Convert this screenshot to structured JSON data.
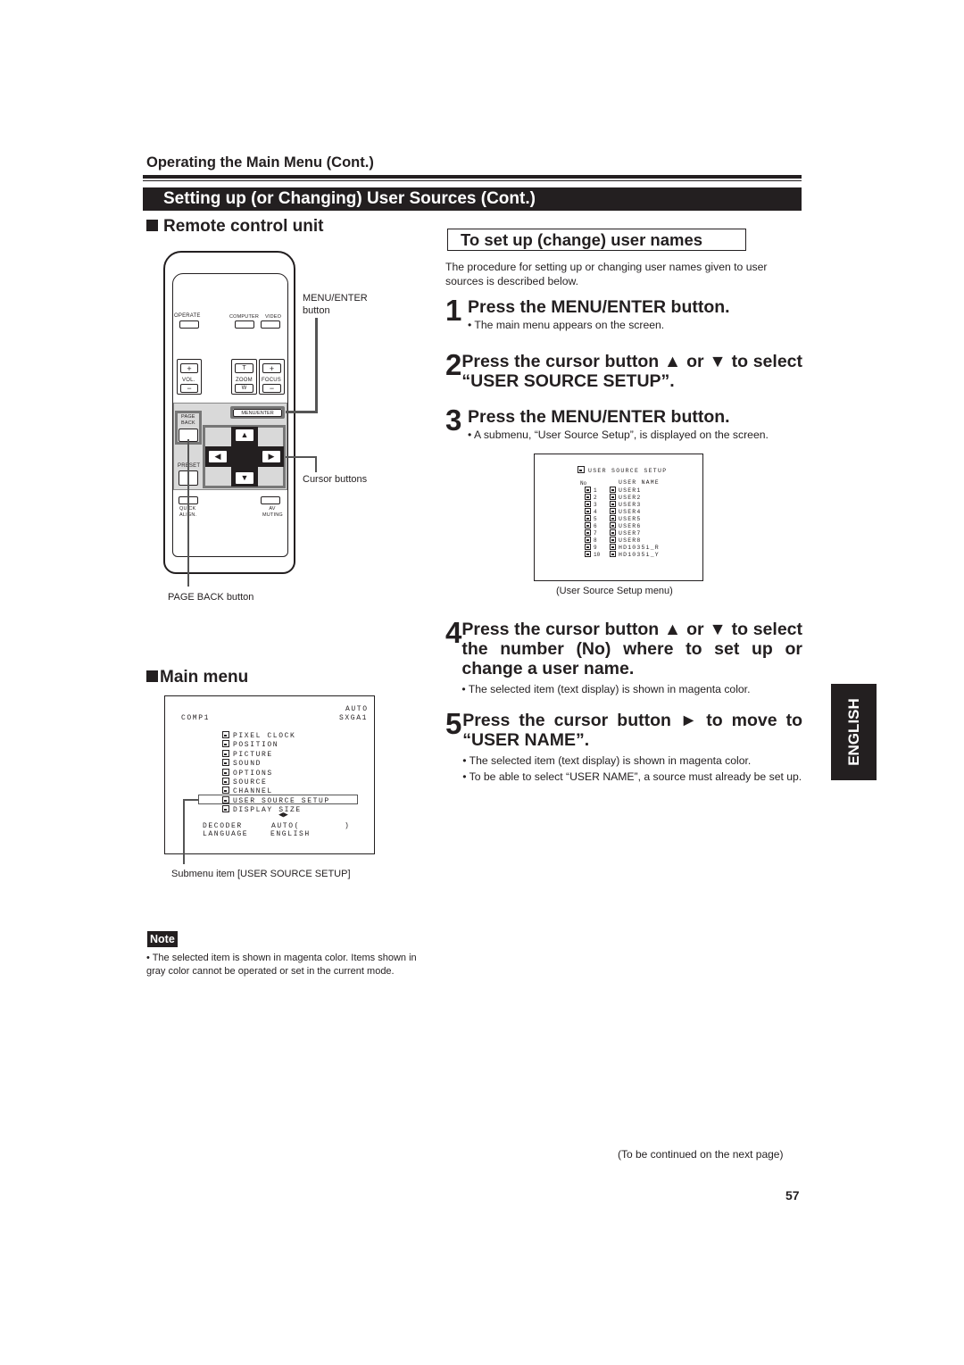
{
  "header": {
    "section": "Operating the Main Menu (Cont.)",
    "banner": "Setting up (or Changing) User Sources (Cont.)"
  },
  "left": {
    "remote_heading": "Remote control unit",
    "remote": {
      "operate": "OPERATE",
      "computer": "COMPUTER",
      "video": "VIDEO",
      "vol": "VOL.",
      "zoom": "ZOOM",
      "focus": "FOCUS",
      "plus": "+",
      "minus": "−",
      "t": "T",
      "w": "W",
      "menu_enter": "MENU/ENTER",
      "page_back": "PAGE BACK",
      "preset": "PRESET",
      "quick_align": "QUICK ALIGN.",
      "av_muting": "AV MUTING",
      "up": "▲",
      "down": "▼",
      "left": "◀",
      "right": "▶"
    },
    "callouts": {
      "menu_enter_line1": "MENU/ENTER",
      "menu_enter_line2": "button",
      "cursor": "Cursor buttons",
      "page_back": "PAGE BACK button"
    },
    "main_menu_heading": "Main menu",
    "main_menu": {
      "source": "COMP1",
      "mode_top": "AUTO",
      "mode_bottom": "SXGA1",
      "items": [
        "PIXEL CLOCK",
        "POSITION",
        "PICTURE",
        "SOUND",
        "OPTIONS",
        "SOURCE",
        "CHANNEL",
        "USER SOURCE SETUP",
        "DISPLAY SIZE"
      ],
      "selected_item": "USER SOURCE SETUP",
      "arrows": "◀▶",
      "decoder_label": "DECODER",
      "decoder_value": "AUTO(",
      "decoder_close": ")",
      "language_label": "LANGUAGE",
      "language_value": "ENGLISH"
    },
    "main_menu_caption": "Submenu item [USER SOURCE SETUP]",
    "note_label": "Note",
    "note_text": "• The selected item is shown in magenta color. Items shown in gray color cannot be operated or set in the current mode."
  },
  "right": {
    "box_heading": "To set up (change) user names",
    "intro": "The procedure for setting up or changing user names given to user sources is described below.",
    "steps": [
      {
        "num": "1",
        "title": "Press the MENU/ENTER button.",
        "bullets": [
          "• The main menu appears on the screen."
        ]
      },
      {
        "num": "2",
        "title": "Press the cursor button ▲ or ▼  to select “USER SOURCE SETUP”.",
        "bullets": []
      },
      {
        "num": "3",
        "title": "Press the MENU/ENTER button.",
        "bullets": [
          "• A submenu, “User Source Setup”, is displayed on the screen."
        ]
      },
      {
        "num": "4",
        "title": "Press the cursor button ▲ or ▼ to select the number (No) where to set up or change a user name.",
        "bullets": [
          "• The selected item (text display) is shown in magenta color."
        ]
      },
      {
        "num": "5",
        "title": "Press the cursor button ► to move to “USER NAME”.",
        "bullets": [
          "• The selected item (text display) is shown in magenta color.",
          "• To be able to select “USER NAME”, a source must already be set up."
        ]
      }
    ],
    "user_source_menu": {
      "title": "USER SOURCE SETUP",
      "col_no": "No",
      "col_name": "USER NAME",
      "rows": [
        {
          "no": "1",
          "name": "USER1"
        },
        {
          "no": "2",
          "name": "USER2"
        },
        {
          "no": "3",
          "name": "USER3"
        },
        {
          "no": "4",
          "name": "USER4"
        },
        {
          "no": "5",
          "name": "USER5"
        },
        {
          "no": "6",
          "name": "USER6"
        },
        {
          "no": "7",
          "name": "USER7"
        },
        {
          "no": "8",
          "name": "USER8"
        },
        {
          "no": "9",
          "name": "HD1035i_R"
        },
        {
          "no": "10",
          "name": "HD1035i_Y"
        }
      ]
    },
    "user_source_caption": "(User Source Setup menu)"
  },
  "side_tab": "ENGLISH",
  "footer": {
    "continued": "(To be continued on the next page)",
    "page_number": "57"
  }
}
